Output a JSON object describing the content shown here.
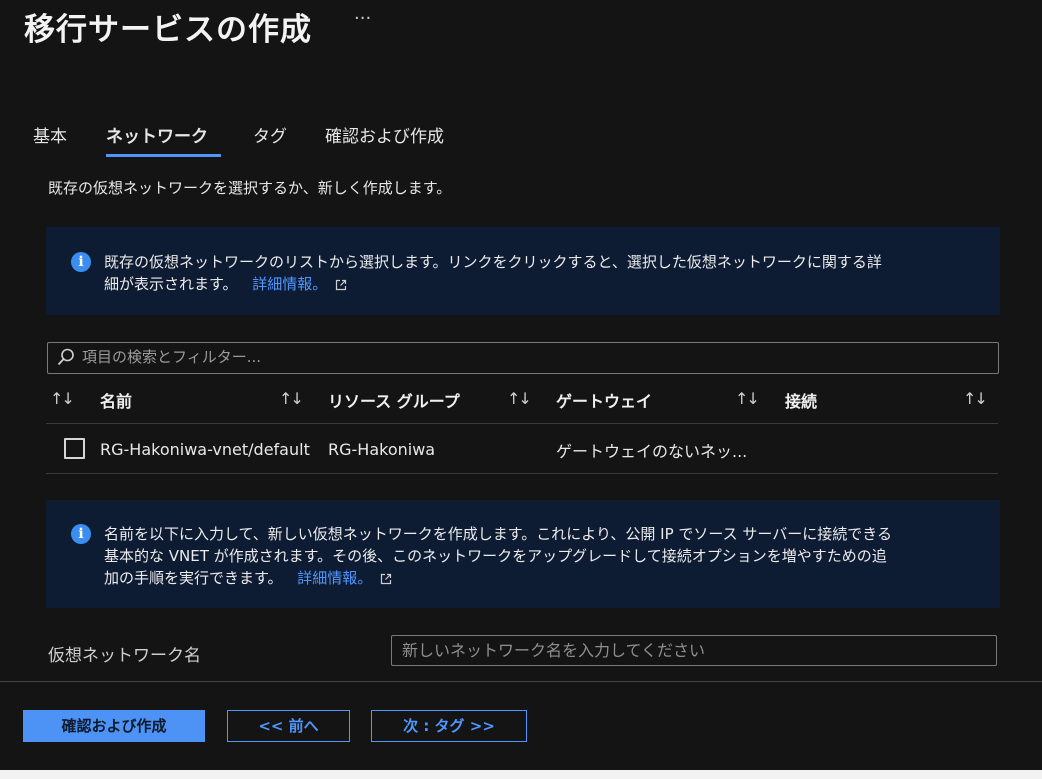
{
  "header": {
    "title": "移行サービスの作成",
    "more": "···"
  },
  "tabs": [
    {
      "label": "基本",
      "active": false
    },
    {
      "label": "ネットワーク",
      "active": true
    },
    {
      "label": "タグ",
      "active": false
    },
    {
      "label": "確認および作成",
      "active": false
    }
  ],
  "intro": "既存の仮想ネットワークを選択するか、新しく作成します。",
  "info1": {
    "line1": "既存の仮想ネットワークのリストから選択します。リンクをクリックすると、選択した仮想ネットワークに関する詳",
    "line2": "細が表示されます。",
    "link": "詳細情報。"
  },
  "search": {
    "placeholder": "項目の検索とフィルター..."
  },
  "table": {
    "headers": [
      "名前",
      "リソース グループ",
      "ゲートウェイ",
      "接続"
    ],
    "rows": [
      {
        "name": "RG-Hakoniwa-vnet/default",
        "resource_group": "RG-Hakoniwa",
        "gateway": "ゲートウェイのないネッ...",
        "connection": ""
      }
    ]
  },
  "info2": {
    "line1": "名前を以下に入力して、新しい仮想ネットワークを作成します。これにより、公開 IP でソース サーバーに接続できる",
    "line2": "基本的な VNET が作成されます。その後、このネットワークをアップグレードして接続オプションを増やすための追",
    "line3": "加の手順を実行できます。",
    "link": "詳細情報。"
  },
  "vnet": {
    "label": "仮想ネットワーク名",
    "placeholder": "新しいネットワーク名を入力してください",
    "value": ""
  },
  "footer": {
    "review_create": "確認および作成",
    "prev": "<< 前へ",
    "next": "次 : タグ >>"
  },
  "colors": {
    "accent": "#4f97ff",
    "info_bg": "#0d1b33",
    "background": "#141414",
    "primary_button": "#4d93f5"
  },
  "icons": {
    "info": "info-icon",
    "external_link": "external-link-icon",
    "search": "search-icon",
    "sort": "sort-arrows-icon",
    "more": "ellipsis-icon"
  }
}
